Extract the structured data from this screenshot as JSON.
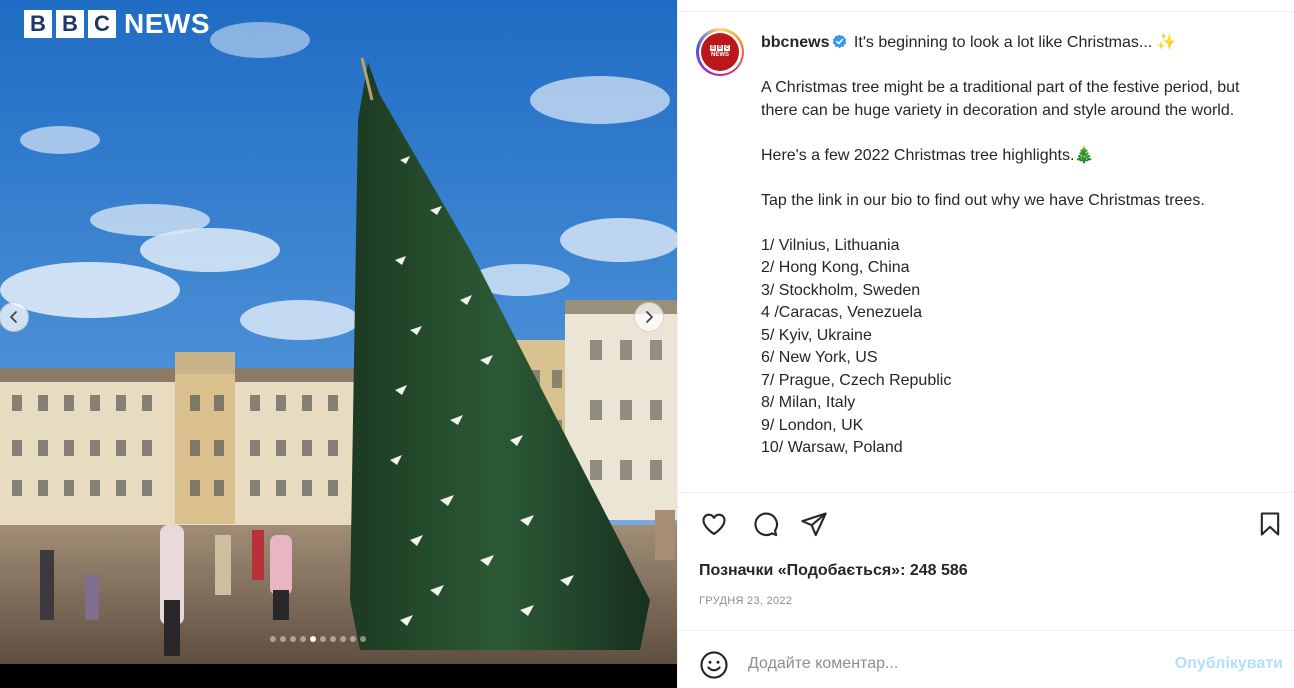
{
  "media": {
    "brand_blocks": [
      "B",
      "B",
      "C"
    ],
    "brand_word": "NEWS",
    "carousel": {
      "total": 10,
      "active_index": 4
    },
    "icons": {
      "prev": "chevron-left-icon",
      "next": "chevron-right-icon"
    }
  },
  "post": {
    "username": "bbcnews",
    "verified": true,
    "title_line": "It's beginning to look a lot like Christmas... ✨",
    "paragraphs": [
      "A Christmas tree might be a traditional part of the festive period, but there can be huge variety in decoration and style around the world.",
      "Here's a few 2022 Christmas tree highlights.🎄",
      "Tap the link in our bio to find out why we have Christmas trees."
    ],
    "locations": [
      "1/ Vilnius, Lithuania",
      "2/ Hong Kong, China",
      "3/ Stockholm, Sweden",
      "4 /Caracas, Venezuela",
      "5/ Kyiv, Ukraine",
      "6/ New York, US",
      "7/ Prague, Czech Republic",
      "8/ Milan, Italy",
      "9/ London, UK",
      "10/ Warsaw, Poland"
    ]
  },
  "actions": {
    "likes_text": "Позначки «Подобається»: 248 586",
    "date_text": "ГРУДНЯ 23, 2022"
  },
  "comment": {
    "placeholder": "Додайте коментар...",
    "publish_label": "Опублікувати"
  },
  "colors": {
    "publish_disabled": "#b2dffc",
    "verified_blue": "#3897f0",
    "bbc_red": "#bb1919"
  }
}
